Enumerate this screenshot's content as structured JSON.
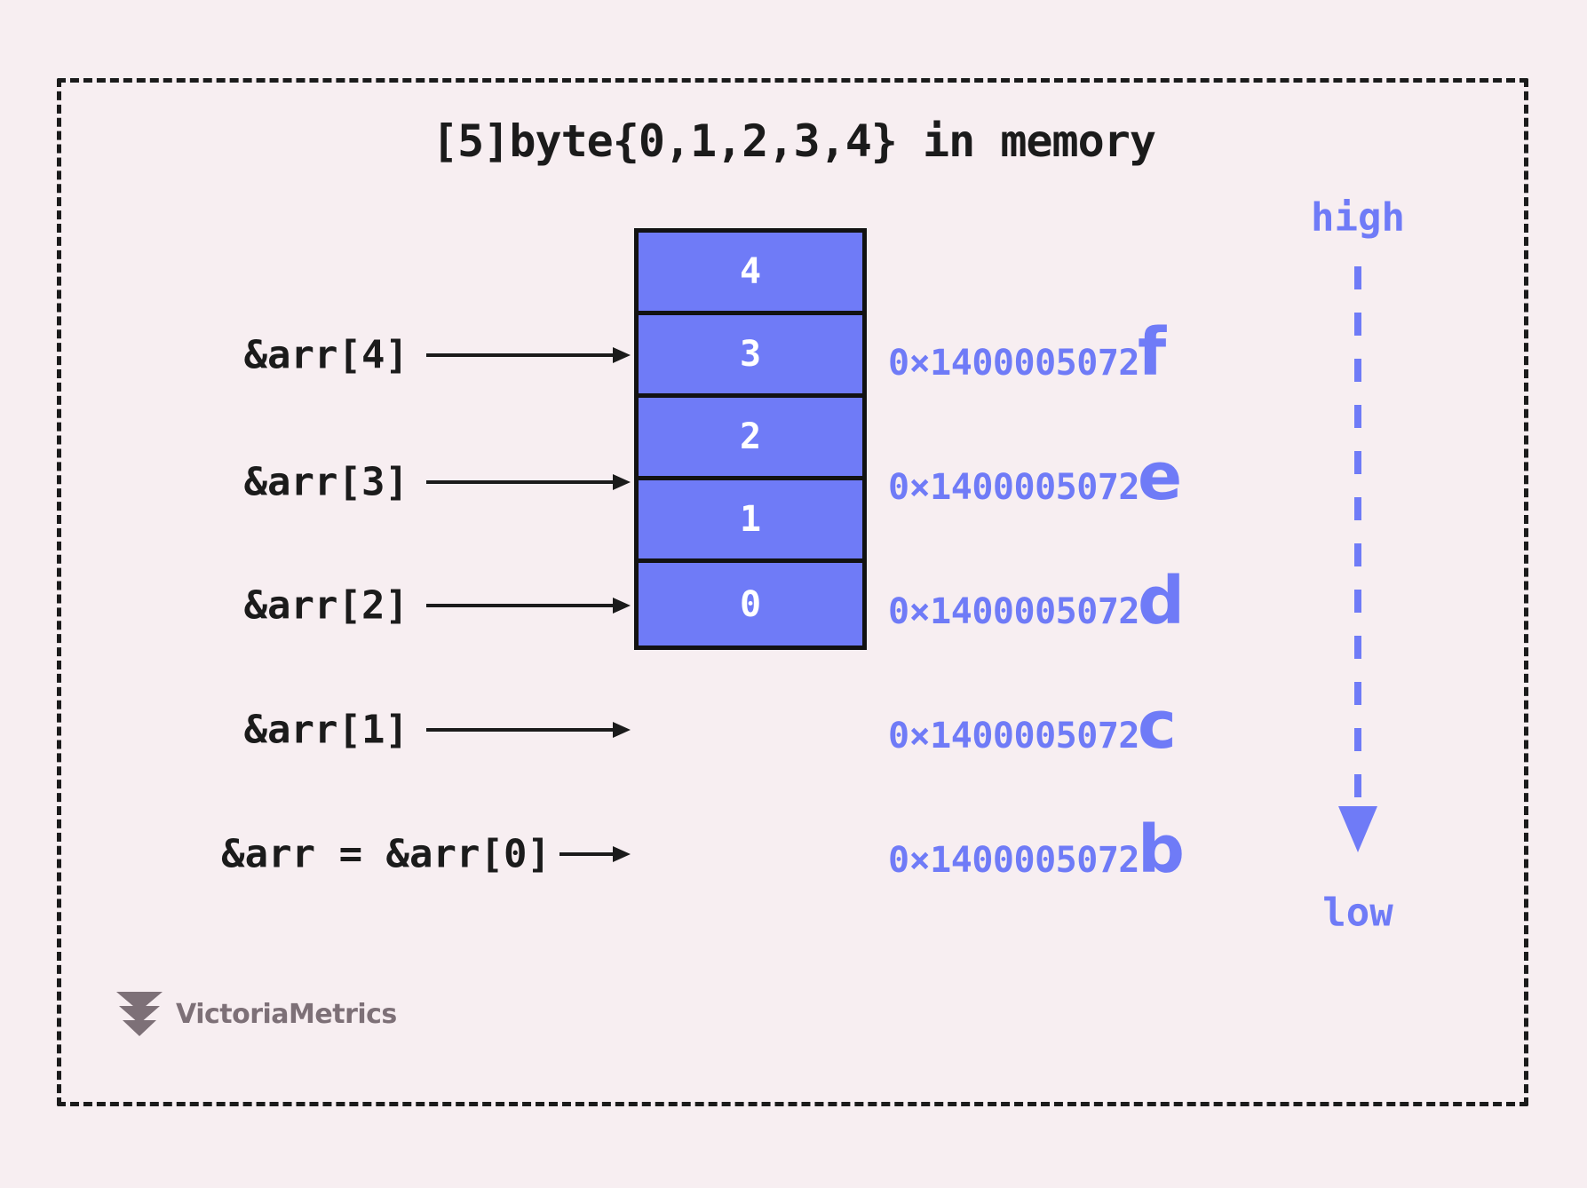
{
  "diagram": {
    "title": "[5]byte{0,1,2,3,4} in memory",
    "colors": {
      "background": "#f7eef1",
      "frame": "#1b1b1b",
      "cell_fill": "#6f7bf7",
      "cell_border": "#121212",
      "cell_text": "#ffffff",
      "accent": "#6f7bf7",
      "label_text": "#1b1b1b",
      "logo_text": "#7d7077"
    },
    "cells": [
      {
        "value": "4",
        "pointer": "&arr[4]",
        "address_hex": "0×1400005072",
        "address_suffix": "f"
      },
      {
        "value": "3",
        "pointer": "&arr[3]",
        "address_hex": "0×1400005072",
        "address_suffix": "e"
      },
      {
        "value": "2",
        "pointer": "&arr[2]",
        "address_hex": "0×1400005072",
        "address_suffix": "d"
      },
      {
        "value": "1",
        "pointer": "&arr[1]",
        "address_hex": "0×1400005072",
        "address_suffix": "c"
      },
      {
        "value": "0",
        "pointer": "&arr = &arr[0]",
        "address_hex": "0×1400005072",
        "address_suffix": "b"
      }
    ],
    "axis": {
      "high_label": "high",
      "low_label": "low",
      "direction": "downward"
    },
    "logo": {
      "name": "VictoriaMetrics"
    }
  }
}
